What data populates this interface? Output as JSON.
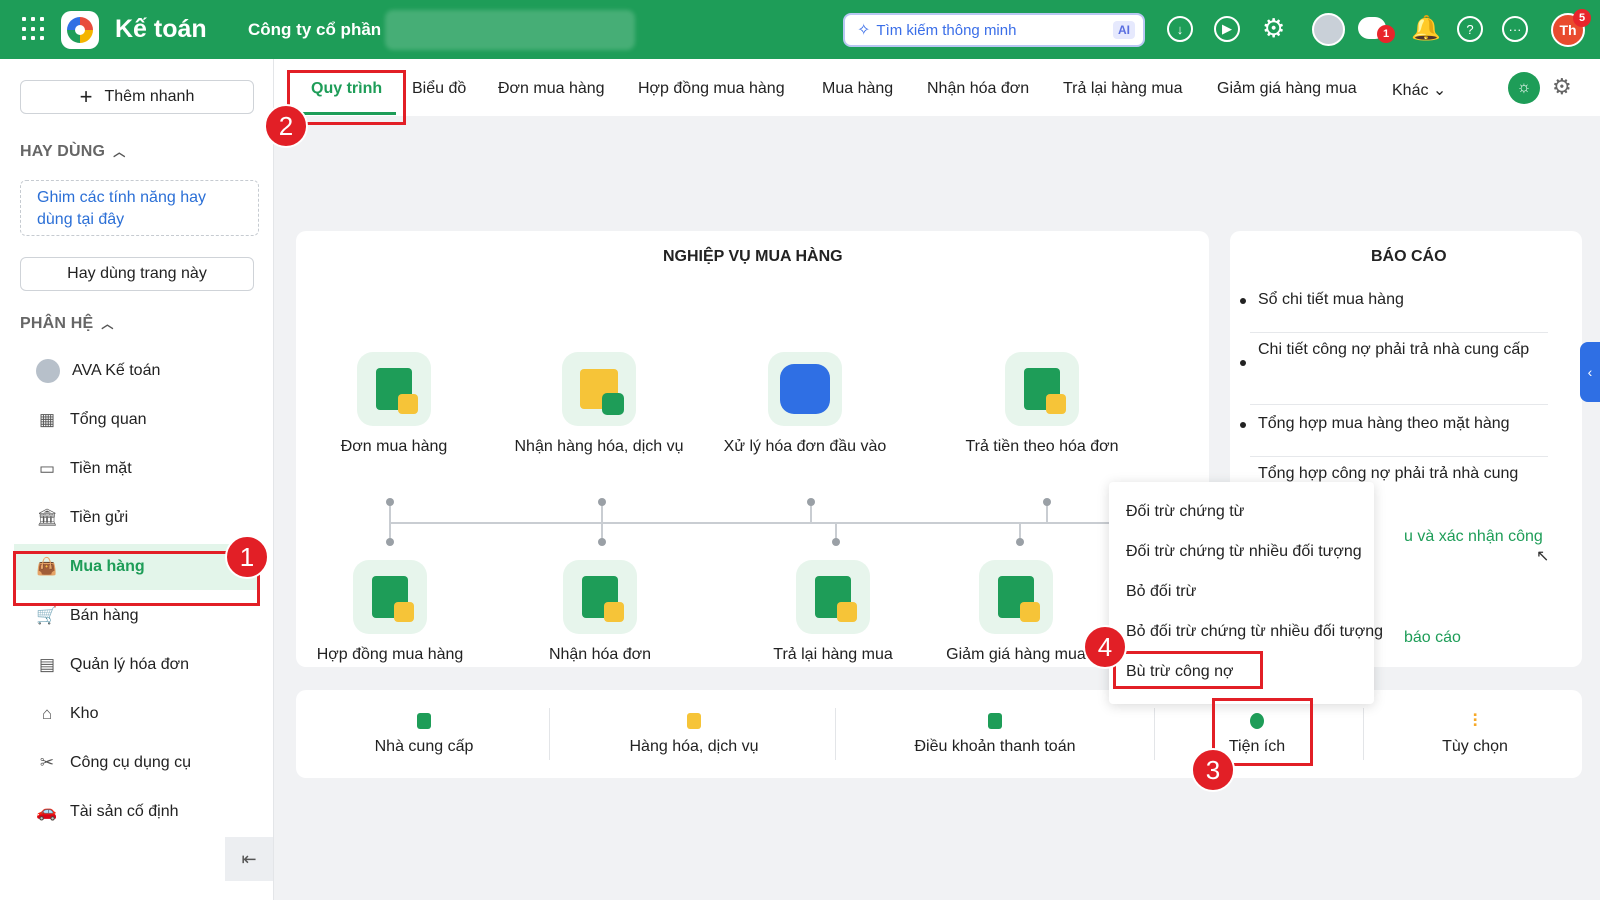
{
  "app": {
    "title": "Kế toán",
    "company": "Công ty cổ phần",
    "search_placeholder": "Tìm kiếm thông minh",
    "ai_badge": "AI",
    "chat_badge": "1",
    "user_initials": "Th",
    "user_badge": "5"
  },
  "sidebar": {
    "quick_add": "Thêm nhanh",
    "favorites_head": "HAY DÙNG",
    "pin_hint": "Ghim các tính năng hay dùng tại đây",
    "favorite_this_page": "Hay dùng trang này",
    "modules_head": "PHÂN HỆ",
    "items": [
      {
        "label": "AVA Kế toán",
        "icon": "ava-avatar-icon"
      },
      {
        "label": "Tổng quan",
        "icon": "dashboard-icon"
      },
      {
        "label": "Tiền mặt",
        "icon": "cash-icon"
      },
      {
        "label": "Tiền gửi",
        "icon": "bank-icon"
      },
      {
        "label": "Mua hàng",
        "icon": "shopping-bag-icon"
      },
      {
        "label": "Bán hàng",
        "icon": "cart-icon"
      },
      {
        "label": "Quản lý hóa đơn",
        "icon": "invoice-icon"
      },
      {
        "label": "Kho",
        "icon": "warehouse-icon"
      },
      {
        "label": "Công cụ dụng cụ",
        "icon": "tools-icon"
      },
      {
        "label": "Tài sản cố định",
        "icon": "car-icon"
      }
    ]
  },
  "tabs": [
    "Quy trình",
    "Biểu đồ",
    "Đơn mua hàng",
    "Hợp đồng mua hàng",
    "Mua hàng",
    "Nhận hóa đơn",
    "Trả lại hàng mua",
    "Giảm giá hàng mua",
    "Khác"
  ],
  "workflow": {
    "title": "NGHIỆP VỤ MUA HÀNG",
    "top": [
      "Đơn mua hàng",
      "Nhận hàng hóa, dịch vụ",
      "Xử lý hóa đơn đầu vào",
      "Trả tiền theo hóa đơn"
    ],
    "bottom": [
      "Hợp đồng mua hàng",
      "Nhận hóa đơn",
      "Trả lại hàng mua",
      "Giảm giá hàng mua"
    ]
  },
  "reports": {
    "title": "BÁO CÁO",
    "items": [
      "Sổ chi tiết mua hàng",
      "Chi tiết công nợ phải trả nhà cung cấp",
      "Tổng hợp mua hàng theo mặt hàng",
      "Tổng hợp công nợ phải trả nhà cung"
    ],
    "link_partial": "u và xác nhận công",
    "link_more": "báo cáo"
  },
  "dropdown": [
    "Đối trừ chứng từ",
    "Đối trừ chứng từ nhiều đối tượng",
    "Bỏ đối trừ",
    "Bỏ đối trừ chứng từ nhiều đối tượng",
    "Bù trừ công nợ"
  ],
  "bottom": [
    "Nhà cung cấp",
    "Hàng hóa, dịch vụ",
    "Điều khoản thanh toán",
    "Tiện ích",
    "Tùy chọn"
  ],
  "annotations": [
    "1",
    "2",
    "3",
    "4"
  ],
  "colors": {
    "brand": "#1e9d58",
    "annotation": "#e21f26",
    "link": "#2b6fd6"
  }
}
